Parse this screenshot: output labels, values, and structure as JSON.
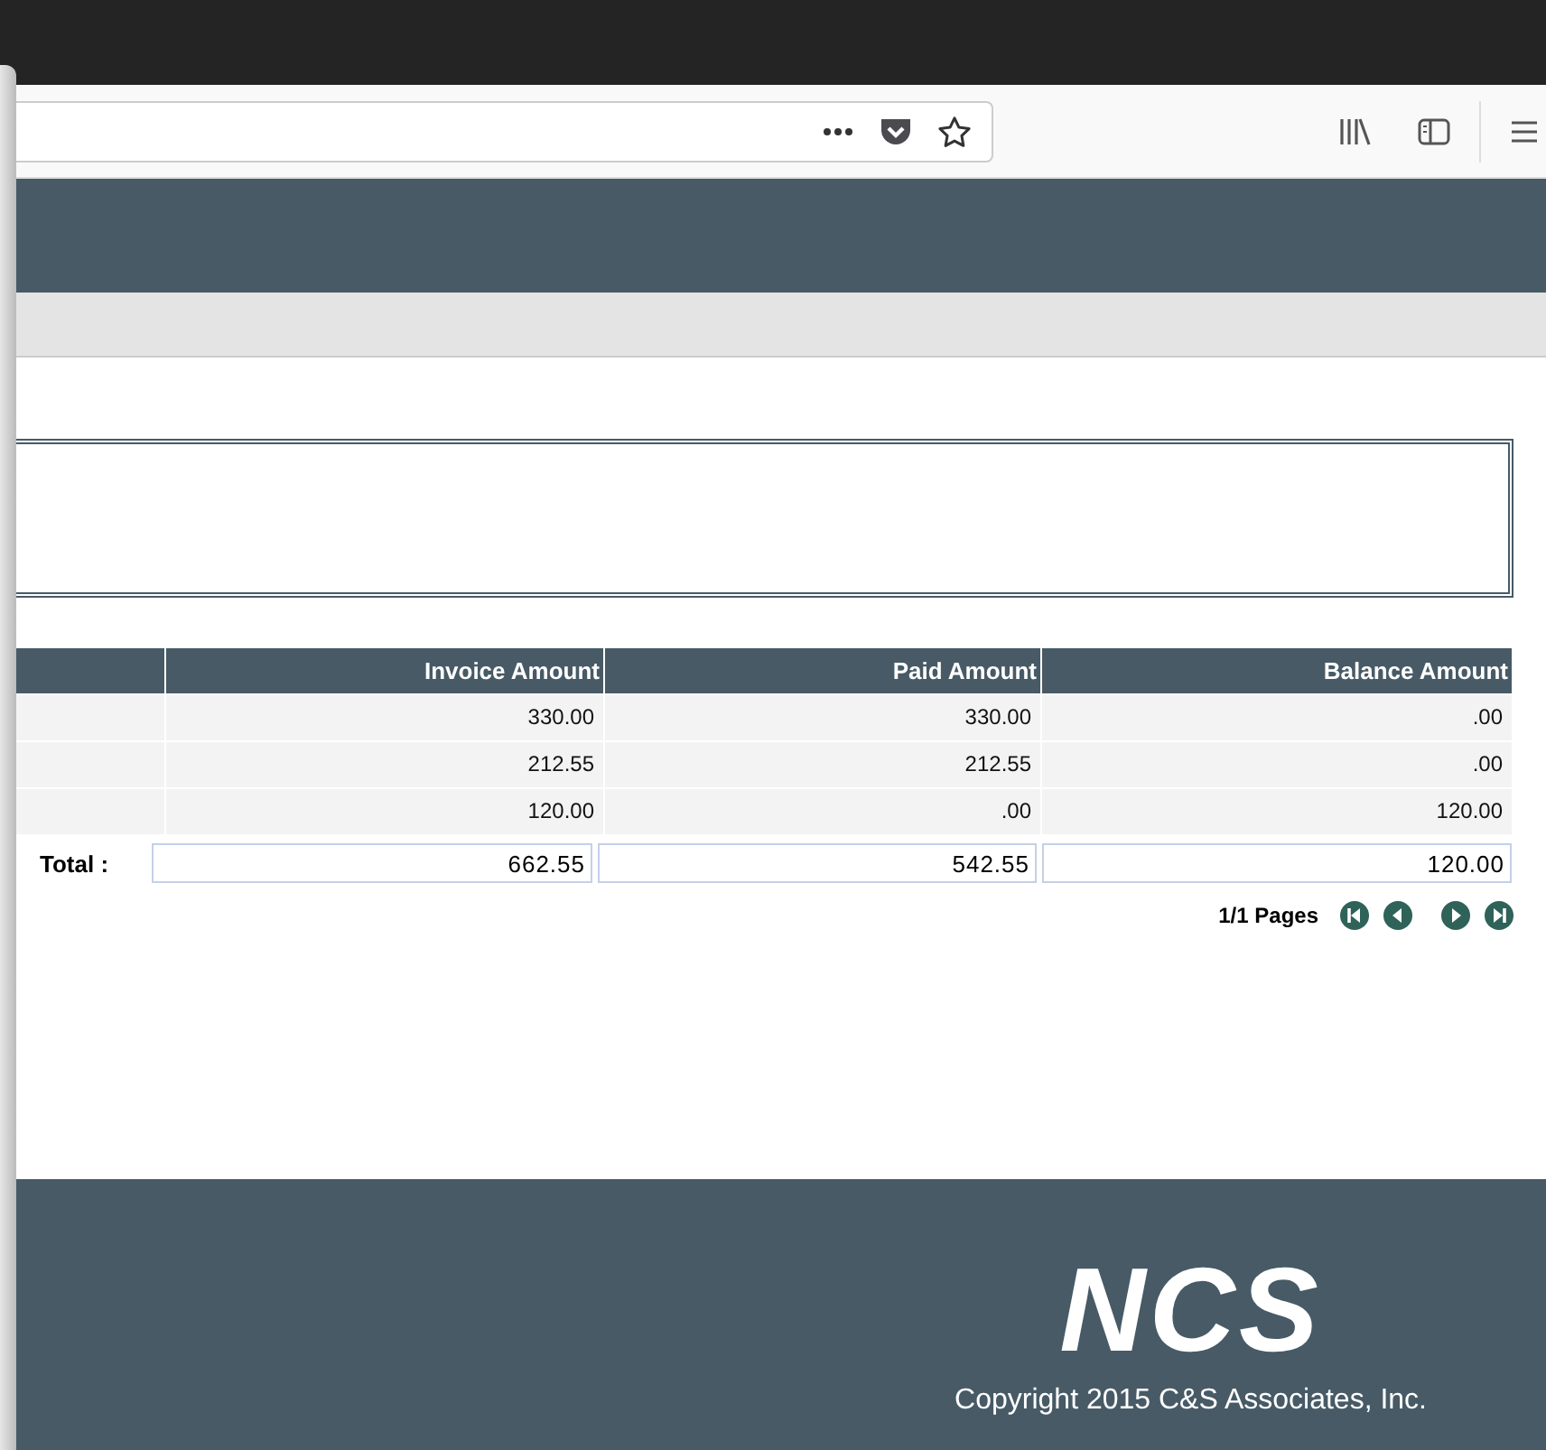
{
  "table": {
    "columns": [
      "Invoice Amount",
      "Paid Amount",
      "Balance Amount"
    ],
    "rows": [
      [
        "330.00",
        "330.00",
        ".00"
      ],
      [
        "212.55",
        "212.55",
        ".00"
      ],
      [
        "120.00",
        ".00",
        "120.00"
      ]
    ],
    "total": {
      "label": "Total :",
      "values": [
        "662.55",
        "542.55",
        "120.00"
      ]
    }
  },
  "pagination": {
    "label": "1/1 Pages"
  },
  "footer": {
    "logo": "NCS",
    "copyright": "Copyright 2015 C&S Associates, Inc."
  }
}
